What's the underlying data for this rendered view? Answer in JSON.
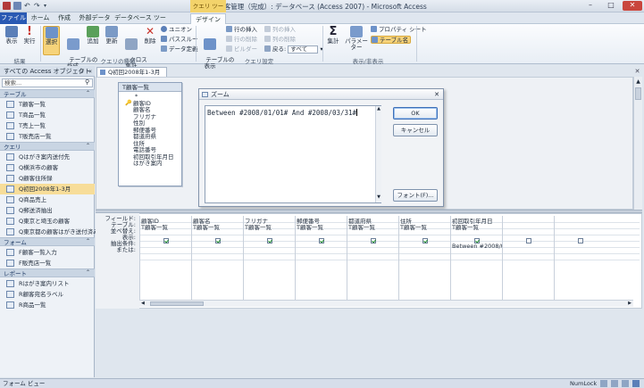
{
  "window": {
    "title": "顧客管理（完成）: データベース (Access 2007) - Microsoft Access",
    "context_tab_header": "クエリ ツール",
    "minimize": "–",
    "maximize": "□",
    "close": "✕"
  },
  "ribbon_tabs": [
    "ファイル",
    "ホーム",
    "作成",
    "外部データ",
    "データベース ツール",
    "デザイン"
  ],
  "ribbon": {
    "results": {
      "view": "表示",
      "run": "実行",
      "group": "結果"
    },
    "query_type": {
      "select": "選択",
      "make_table": "テーブルの\n作成",
      "append": "追加",
      "update": "更新",
      "crosstab": "クロス\n集計",
      "delete": "削除",
      "union": "ユニオン",
      "passthrough": "パススルー",
      "data_definition": "データ定義",
      "group": "クエリの種類"
    },
    "query_setup": {
      "show_table": "テーブルの\n表示",
      "insert_rows": "行の挿入",
      "delete_rows": "行の削除",
      "builder": "ビルダー",
      "insert_columns": "列の挿入",
      "delete_columns": "列の削除",
      "return_label": "戻る:",
      "return_value": "すべて",
      "group": "クエリ設定"
    },
    "show_hide": {
      "totals": "集計",
      "parameters": "パラメーター",
      "property_sheet": "プロパティ シート",
      "table_names": "テーブル名",
      "group": "表示/非表示"
    }
  },
  "nav": {
    "header": "すべての Access オブジェクト",
    "search_placeholder": "検索...",
    "groups": [
      {
        "label": "テーブル",
        "items": [
          "T顧客一覧",
          "T商品一覧",
          "T売上一覧",
          "T販売店一覧"
        ]
      },
      {
        "label": "クエリ",
        "items": [
          "Qはがき案内送付先",
          "Q横浜市の顧客",
          "Q顧客住所録",
          "Q初回2008年1-3月",
          "Q商品売上",
          "Q郵送済抽出",
          "Q東京と埼玉の顧客",
          "Q東京都の顧客はがき送付済み"
        ]
      },
      {
        "label": "フォーム",
        "items": [
          "F顧客一覧入力",
          "F販売店一覧"
        ]
      },
      {
        "label": "レポート",
        "items": [
          "Rはがき案内リスト",
          "R顧客宛名ラベル",
          "R商品一覧"
        ]
      }
    ],
    "selected": "Q初回2008年1-3月"
  },
  "document_tab": "Q初回2008年1-3月",
  "table_box": {
    "title": "T顧客一覧",
    "fields": [
      "*",
      "顧客ID",
      "顧客名",
      "フリガナ",
      "性別",
      "郵便番号",
      "都道府県",
      "住所",
      "電話番号",
      "初回取引年月日",
      "はがき案内"
    ]
  },
  "zoom": {
    "title": "ズーム",
    "text": "Between #2008/01/01# And #2008/03/31#",
    "ok": "OK",
    "cancel": "キャンセル",
    "font": "フォント(F)..."
  },
  "qbe": {
    "row_labels": [
      "フィールド:",
      "テーブル:",
      "並べ替え:",
      "表示:",
      "抽出条件:",
      "または:"
    ],
    "columns": [
      {
        "field": "顧客ID",
        "table": "T顧客一覧",
        "show": true,
        "criteria": ""
      },
      {
        "field": "顧客名",
        "table": "T顧客一覧",
        "show": true,
        "criteria": ""
      },
      {
        "field": "フリガナ",
        "table": "T顧客一覧",
        "show": true,
        "criteria": ""
      },
      {
        "field": "郵便番号",
        "table": "T顧客一覧",
        "show": true,
        "criteria": ""
      },
      {
        "field": "都道府県",
        "table": "T顧客一覧",
        "show": true,
        "criteria": ""
      },
      {
        "field": "住所",
        "table": "T顧客一覧",
        "show": true,
        "criteria": ""
      },
      {
        "field": "初回取引年月日",
        "table": "T顧客一覧",
        "show": true,
        "criteria": "Between #2008/01/0"
      },
      {
        "field": "",
        "table": "",
        "show": false,
        "criteria": ""
      },
      {
        "field": "",
        "table": "",
        "show": false,
        "criteria": ""
      },
      {
        "field": "",
        "table": "",
        "show": false,
        "criteria": ""
      }
    ]
  },
  "status": {
    "left": "フォーム ビュー",
    "numlock": "NumLock"
  },
  "colors": {
    "file_tab": "#2a59b3",
    "context": "#f3d36b",
    "selected": "#f7dd99",
    "close": "#c9463d"
  }
}
